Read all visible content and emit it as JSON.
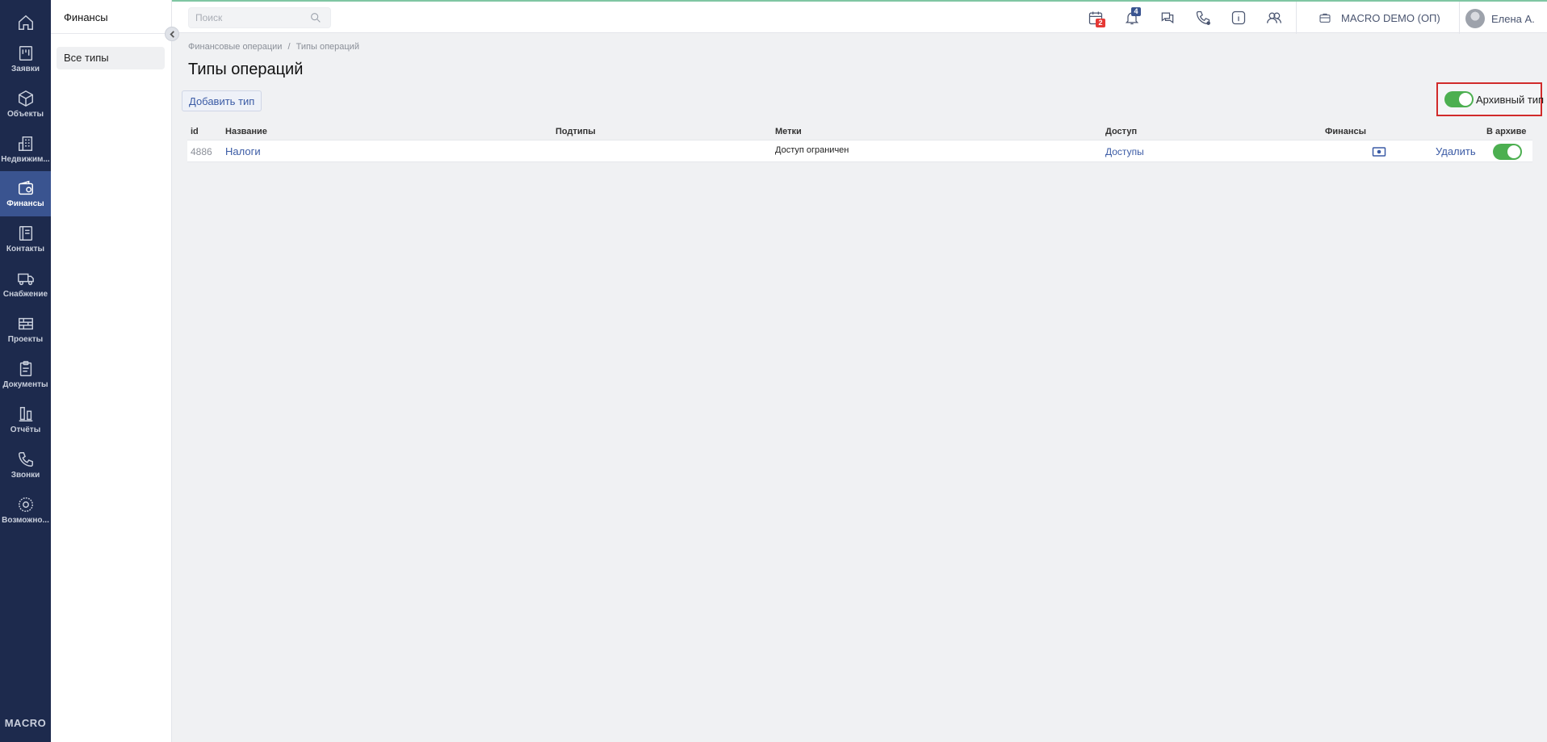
{
  "nav": {
    "brand": "MACRO",
    "items": [
      {
        "label": "",
        "icon": "home-icon"
      },
      {
        "label": "Заявки",
        "icon": "requests-icon"
      },
      {
        "label": "Объекты",
        "icon": "cube-icon"
      },
      {
        "label": "Недвижим...",
        "icon": "building-icon"
      },
      {
        "label": "Финансы",
        "icon": "wallet-icon",
        "active": true
      },
      {
        "label": "Контакты",
        "icon": "contacts-icon"
      },
      {
        "label": "Снабжение",
        "icon": "truck-icon"
      },
      {
        "label": "Проекты",
        "icon": "projects-icon"
      },
      {
        "label": "Документы",
        "icon": "clipboard-icon"
      },
      {
        "label": "Отчёты",
        "icon": "reports-icon"
      },
      {
        "label": "Звонки",
        "icon": "phone-icon"
      },
      {
        "label": "Возможно...",
        "icon": "gear-icon"
      }
    ]
  },
  "subnav": {
    "title": "Финансы",
    "items": [
      {
        "label": "Все типы"
      }
    ]
  },
  "topbar": {
    "search_placeholder": "Поиск",
    "calendar_badge": "2",
    "notifications_badge": "4",
    "company": "MACRO DEMO (ОП)",
    "user": "Елена А."
  },
  "breadcrumb": {
    "parent": "Финансовые операции",
    "separator": "/",
    "current": "Типы операций"
  },
  "page": {
    "title": "Типы операций",
    "add_button": "Добавить тип",
    "archive_toggle_label": "Архивный тип",
    "archive_toggle_on": true
  },
  "table": {
    "columns": {
      "id": "id",
      "name": "Название",
      "subtypes": "Подтипы",
      "tags": "Метки",
      "access": "Доступ",
      "finance": "Финансы",
      "archived": "В архиве"
    },
    "rows": [
      {
        "id": "4886",
        "name": "Налоги",
        "subtypes": "",
        "tags": "Доступ ограничен",
        "access_link": "Доступы",
        "finance_icon": "money-icon",
        "delete_link": "Удалить",
        "archived": true
      }
    ]
  },
  "colors": {
    "rail_bg": "#1d2a4d",
    "rail_active": "#3a5490",
    "link": "#3b5ba5",
    "toggle_on": "#4caf50",
    "highlight_border": "#d12b2b",
    "badge_red": "#e53935",
    "badge_blue": "#3a5490"
  }
}
